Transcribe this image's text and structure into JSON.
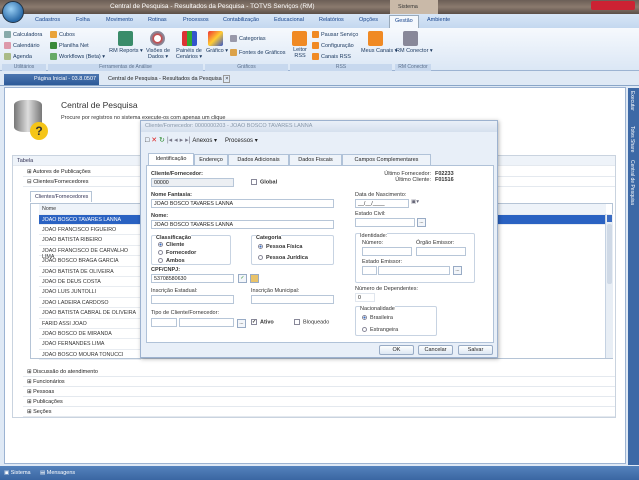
{
  "window": {
    "title": "Central de Pesquisa - Resultados da Pesquisa - TOTVS Serviços (RM)",
    "context_tab": "Sistema"
  },
  "ribbon_tabs": [
    "Cadastros",
    "Folha",
    "Movimento",
    "Rotinas",
    "Processos",
    "Contabilização",
    "Educacional",
    "Relatórios",
    "Opções",
    "Gestão",
    "Ambiente"
  ],
  "ribbon": {
    "utilitarios": {
      "label": "Utilitários",
      "items": [
        "Calculadora",
        "Calendário",
        "Agenda"
      ]
    },
    "analise": {
      "label": "Ferramentas de Análise",
      "items": [
        "Cubos",
        "Planilha Net",
        "Workflows (Beta) ▾"
      ],
      "big": [
        "RM Reports ▾",
        "Visões de Dados ▾",
        "Painéis de Cenários ▾"
      ]
    },
    "graficos": {
      "label": "Gráficos",
      "big": "Gráfico ▾",
      "items": [
        "Categorias",
        "Fontes de Gráficos"
      ]
    },
    "rss": {
      "label": "RSS",
      "big": "Leitor RSS",
      "items": [
        "Pausar Serviço",
        "Configuração",
        "Canais RSS"
      ],
      "big2": "Meus Canais ▾"
    },
    "conector": {
      "label": "RM Conector",
      "big": "RM Conector ▾"
    }
  },
  "doc_tabs": [
    "Página Inicial - 03.8.0507",
    "Central de Pesquisa - Resultados da Pesquisa"
  ],
  "header": {
    "title": "Central de Pesquisa",
    "subtitle": "Procure por registros no sistema execute-os com apenas um clique"
  },
  "grid": {
    "column": "Tabela",
    "rows_top": [
      "Autores de Publicações",
      "Clientes/Fornecedores"
    ],
    "subtab": "Clientes/Fornecedores",
    "inner_column": "Nome",
    "names": [
      "JOAO BOSCO TAVARES LANNA",
      "JOAO FRANCISCO FIGUEIRO",
      "JOAO BATISTA RIBEIRO",
      "JOAO FRANCISCO DE CARVALHO LIMA",
      "JOAO BOSCO BRAGA GARCIA",
      "JOAO BATISTA DE OLIVEIRA",
      "JOAO DE DEUS COSTA",
      "JOAO LUIS JUNTOLLI",
      "JOAO LADEIRA CARDOSO",
      "JOAO BATISTA CABRAL DE OLIVEIRA",
      "FARID ASSI JOAO",
      "JOAO BOSCO DE MIRANDA",
      "JOAO FERNANDES LIMA",
      "JOAO BOSCO MOURA TONUCCI"
    ],
    "rows_bottom": [
      "Discussão do atendimento",
      "Funcionários",
      "Pessoas",
      "Publicações",
      "Seções"
    ]
  },
  "right_bar": [
    "Executar",
    "Totvs Share",
    "Central de Pesquisa"
  ],
  "status": [
    "Sistema",
    "Mensagens"
  ],
  "dialog": {
    "title": "Cliente/Fornecedor: 0000000203 - JOAO BOSCO TAVARES LANNA",
    "toolbar": {
      "anexos": "Anexos ▾",
      "processos": "Processos ▾"
    },
    "tabs": [
      "Identificação",
      "Endereço",
      "Dados Adicionais",
      "Dados Fiscais",
      "Campos Complementares"
    ],
    "codigo_label": "Cliente/Fornecedor:",
    "codigo": "00000",
    "global": "Global",
    "ultimo_fornecedor_label": "Último Fornecedor:",
    "ultimo_fornecedor": "F02233",
    "ultimo_cliente_label": "Último Cliente:",
    "ultimo_cliente": "F01516",
    "nome_fantasia_label": "Nome Fantasia:",
    "nome_fantasia": "JOAO BOSCO TAVARES LANNA",
    "nome_label": "Nome:",
    "nome": "JOAO BOSCO TAVARES LANNA",
    "nascimento_label": "Data de Nascimento:",
    "nascimento": "__/__/____",
    "estado_civil_label": "Estado Civil:",
    "classificacao": {
      "label": "Classificação",
      "options": [
        "Cliente",
        "Fornecedor",
        "Ambos"
      ],
      "selected": "Cliente"
    },
    "categoria": {
      "label": "Categoria",
      "options": [
        "Pessoa Física",
        "Pessoa Jurídica"
      ],
      "selected": "Pessoa Física"
    },
    "identidade": {
      "label": "Identidade:",
      "numero": "Número:",
      "orgao": "Órgão Emissor:",
      "estado": "Estado Emissor:"
    },
    "cpf_label": "CPF/CNPJ:",
    "cpf": "53708580630",
    "dependentes_label": "Número de Dependentes:",
    "dependentes": "0",
    "insc_estadual": "Inscrição Estadual:",
    "insc_municipal": "Inscrição Municipal:",
    "nacionalidade": {
      "label": "Nacionalidade",
      "options": [
        "Brasileira",
        "Estrangeira"
      ],
      "selected": "Brasileira"
    },
    "tipo_label": "Tipo de Cliente/Fornecedor:",
    "ativo": "Ativo",
    "bloqueado": "Bloqueado",
    "buttons": {
      "ok": "OK",
      "cancel": "Cancelar",
      "save": "Salvar"
    }
  }
}
